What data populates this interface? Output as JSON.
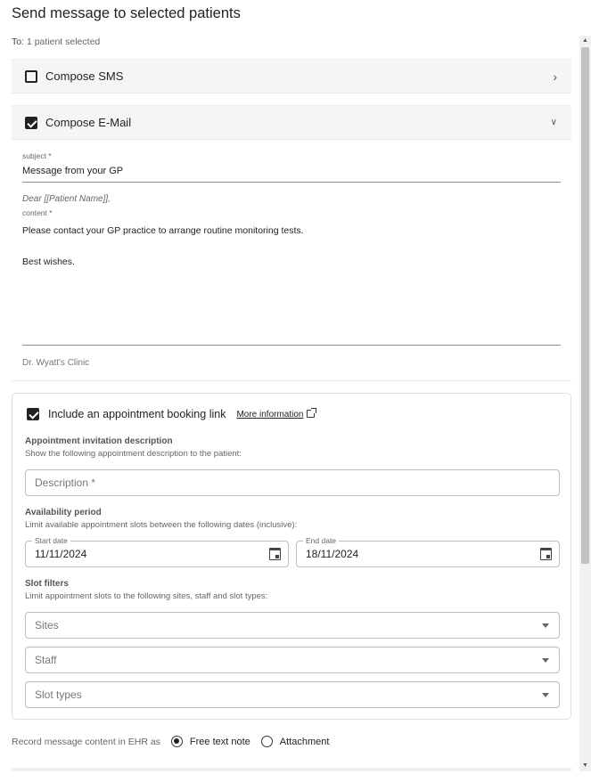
{
  "title": "Send message to selected patients",
  "to": {
    "label": "To:",
    "value": "1 patient selected"
  },
  "sms": {
    "label": "Compose SMS",
    "checked": false,
    "icon": "chevron-right-icon"
  },
  "email": {
    "label": "Compose E-Mail",
    "checked": true,
    "icon": "chevron-down-icon",
    "subject_label": "subject *",
    "subject_value": "Message from your GP",
    "greeting": "Dear [[Patient Name]],",
    "content_label": "content *",
    "content_value": "Please contact your GP practice to arrange routine monitoring tests.\n\nBest wishes.",
    "signoff": "Dr. Wyatt's Clinic"
  },
  "booking": {
    "checked": true,
    "label": "Include an appointment booking link",
    "more_info": "More information",
    "invitation_title": "Appointment invitation description",
    "invitation_desc": "Show the following appointment description to the patient:",
    "description_placeholder": "Description *",
    "availability_title": "Availability period",
    "availability_desc": "Limit available appointment slots between the following dates (inclusive):",
    "start_label": "Start date",
    "start_value": "11/11/2024",
    "end_label": "End date",
    "end_value": "18/11/2024",
    "filters_title": "Slot filters",
    "filters_desc": "Limit appointment slots to the following sites, staff and slot types:",
    "sites": "Sites",
    "staff": "Staff",
    "slot_types": "Slot types"
  },
  "record": {
    "label": "Record message content in EHR as",
    "options": [
      "Free text note",
      "Attachment"
    ],
    "selected": "Free text note"
  },
  "colors": {
    "checkbox": "#212121",
    "header_bg": "#f5f5f5"
  }
}
